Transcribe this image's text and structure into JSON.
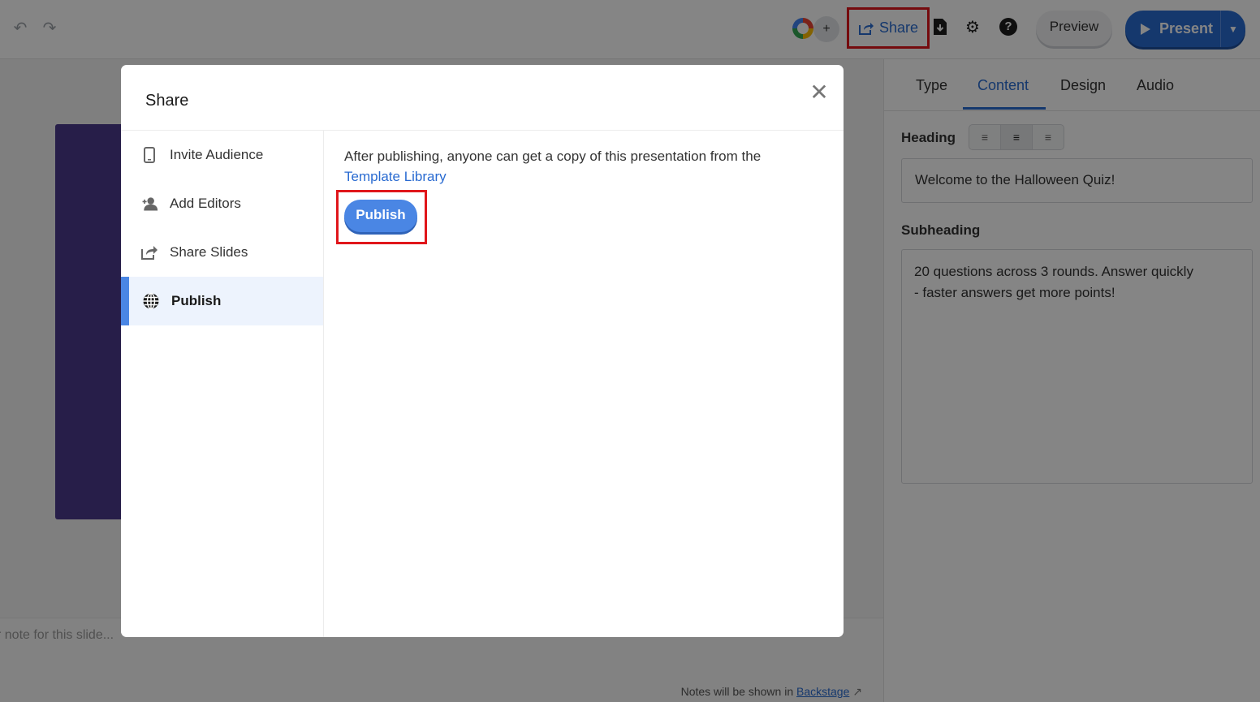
{
  "topbar": {
    "undo_icon": "undo-icon",
    "redo_icon": "redo-icon",
    "add_collaborator_label": "+",
    "share_label": "Share",
    "preview_label": "Preview",
    "present_label": "Present"
  },
  "right_panel": {
    "tabs": [
      {
        "label": "Type"
      },
      {
        "label": "Content"
      },
      {
        "label": "Design"
      },
      {
        "label": "Audio"
      }
    ],
    "active_tab": "Content",
    "heading_label": "Heading",
    "heading_value": "Welcome to the Halloween Quiz!",
    "subheading_label": "Subheading",
    "subheading_value": "20 questions across 3 rounds. Answer quickly\n- faster answers get more points!"
  },
  "notes": {
    "placeholder": "r note for this slide...",
    "footer_text": "Notes will be shown in ",
    "footer_link": "Backstage"
  },
  "modal": {
    "title": "Share",
    "close_icon": "close-icon",
    "nav": [
      {
        "label": "Invite Audience",
        "icon": "tablet-icon"
      },
      {
        "label": "Add Editors",
        "icon": "add-user-icon"
      },
      {
        "label": "Share Slides",
        "icon": "share-icon"
      },
      {
        "label": "Publish",
        "icon": "globe-icon"
      }
    ],
    "active_nav": "Publish",
    "publish_text": "After publishing, anyone can get a copy of this presentation from the",
    "publish_link": "Template Library",
    "publish_button": "Publish"
  },
  "colors": {
    "accent": "#2a6bd1",
    "publish_button": "#4a86e4",
    "highlight_box": "#e0161b",
    "slide_thumbnail": "#4b3a8c"
  }
}
